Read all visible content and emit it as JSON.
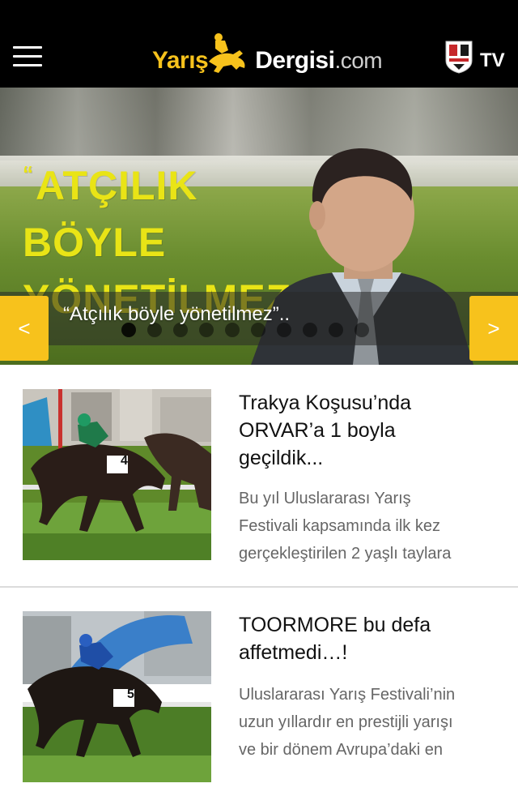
{
  "header": {
    "logo": {
      "part1": "Yarış",
      "part2": "Dergisi",
      "part3": ".com"
    },
    "tv_label": "TV",
    "menu_icon": "hamburger-menu-icon",
    "tv_icon": "tjk-badge-icon"
  },
  "slider": {
    "image_text_lines": [
      "ATÇILIK",
      "BÖYLE",
      "YÖNETİLMEZ”"
    ],
    "image_quote_mark": "“",
    "caption": "“Atçılık böyle yönetilmez”..",
    "prev_label": "<",
    "next_label": ">",
    "dot_count": 10,
    "active_dot": 0
  },
  "articles": [
    {
      "title_lines": [
        "Trakya Koşusu’nda",
        "ORVAR’a 1 boyla",
        "geçildik..."
      ],
      "excerpt_lines": [
        "Bu yıl Uluslararası Yarış",
        "Festivali kapsamında ilk kez",
        "gerçekleştirilen 2 yaşlı taylara"
      ],
      "saddle_number": "4"
    },
    {
      "title_lines": [
        "TOORMORE bu defa",
        "affetmedi…!"
      ],
      "excerpt_lines": [
        "Uluslararası Yarış Festivali’nin",
        "uzun yıllardır en prestijli yarışı",
        "ve bir dönem Avrupa’daki en"
      ],
      "saddle_number": "5"
    }
  ],
  "colors": {
    "accent": "#f7c21c",
    "header_bg": "#000000",
    "quote_yellow": "#e9e416"
  }
}
